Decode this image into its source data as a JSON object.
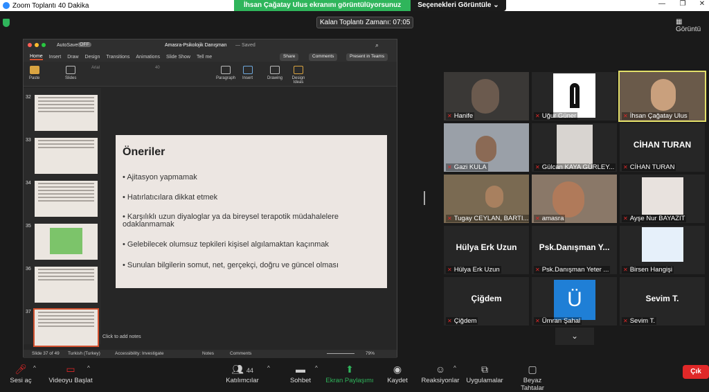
{
  "window": {
    "title": "Zoom Toplantı 40 Dakika",
    "min": "—",
    "restore": "❐",
    "close": "✕"
  },
  "share_banner": {
    "presenter_text": "İhsan Çağatay Ulus ekranını görüntülüyorsunuz",
    "options_label": "Seçenekleri Görüntüle"
  },
  "timer": "Kalan Toplantı Zamanı: 07:05",
  "view_label": "Görüntü",
  "ppt": {
    "autosave": "AutoSave",
    "autosave_state": "OFF",
    "doc_title": "Amasra-Psikolojik Danışman",
    "saved": "— Saved",
    "menu": [
      "Home",
      "Insert",
      "Draw",
      "Design",
      "Transitions",
      "Animations",
      "Slide Show",
      "Tell me"
    ],
    "share": "Share",
    "comments": "Comments",
    "present": "Present in Teams",
    "ribbon": {
      "paste": "Paste",
      "slides": "Slides",
      "font": "Arial",
      "size": "40",
      "paragraph": "Paragraph",
      "insert": "Insert",
      "drawing": "Drawing",
      "design_ideas": "Design Ideas"
    },
    "thumbs": [
      {
        "num": "32",
        "selected": false
      },
      {
        "num": "33",
        "selected": false
      },
      {
        "num": "34",
        "selected": false
      },
      {
        "num": "35",
        "selected": false
      },
      {
        "num": "36",
        "selected": false
      },
      {
        "num": "37",
        "selected": true
      }
    ],
    "slide": {
      "title": "Öneriler",
      "bullets": [
        "Ajitasyon yapmamak",
        "Hatırlatıcılara dikkat etmek",
        "Karşılıklı uzun diyaloglar ya da bireysel terapotik müdahalelere odaklanmamak",
        "Gelebilecek olumsuz tepkileri kişisel algılamaktan kaçınmak",
        "Sunulan bilgilerin somut, net, gerçekçi, doğru ve güncel olması"
      ]
    },
    "notes_hint": "Click to add notes",
    "status": {
      "slide": "Slide 37 of 49",
      "lang": "Turkish (Turkey)",
      "access": "Accessibility: Investigate",
      "notes": "Notes",
      "comments": "Comments",
      "zoom": "79%"
    }
  },
  "participants": [
    {
      "name": "Hanife",
      "big": ""
    },
    {
      "name": "Uğur Güner",
      "big": ""
    },
    {
      "name": "İhsan Çağatay Ulus",
      "big": ""
    },
    {
      "name": "Gazi KULA",
      "big": ""
    },
    {
      "name": "Gülcan KAYA GÜRLEY...",
      "big": ""
    },
    {
      "name": "CİHAN TURAN",
      "big": "CİHAN TURAN"
    },
    {
      "name": "Tugay CEYLAN, BARTI...",
      "big": ""
    },
    {
      "name": "amasra",
      "big": ""
    },
    {
      "name": "Ayşe Nur BAYAZIT",
      "big": ""
    },
    {
      "name": "Hülya Erk Uzun",
      "big": "Hülya Erk Uzun"
    },
    {
      "name": "Psk.Danışman Yeter ...",
      "big": "Psk.Danışman Y..."
    },
    {
      "name": "Birsen Hangişi",
      "big": ""
    },
    {
      "name": "Çiğdem",
      "big": "Çiğdem"
    },
    {
      "name": "Ümran Şahal",
      "big": ""
    },
    {
      "name": "Sevim T.",
      "big": "Sevim T."
    }
  ],
  "toolbar": {
    "audio": "Sesi aç",
    "video": "Videoyu Başlat",
    "participants": "Katılımcılar",
    "participant_count": "44",
    "chat": "Sohbet",
    "share": "Ekran Paylaşımı",
    "record": "Kaydet",
    "reactions": "Reaksiyonlar",
    "apps": "Uygulamalar",
    "whiteboard": "Beyaz Tahtalar",
    "leave": "Çık"
  },
  "colors": {
    "share_green": "#2fb55b",
    "leave_red": "#e02828",
    "ppt_accent": "#d35230",
    "active_speaker": "#e3e06a"
  }
}
